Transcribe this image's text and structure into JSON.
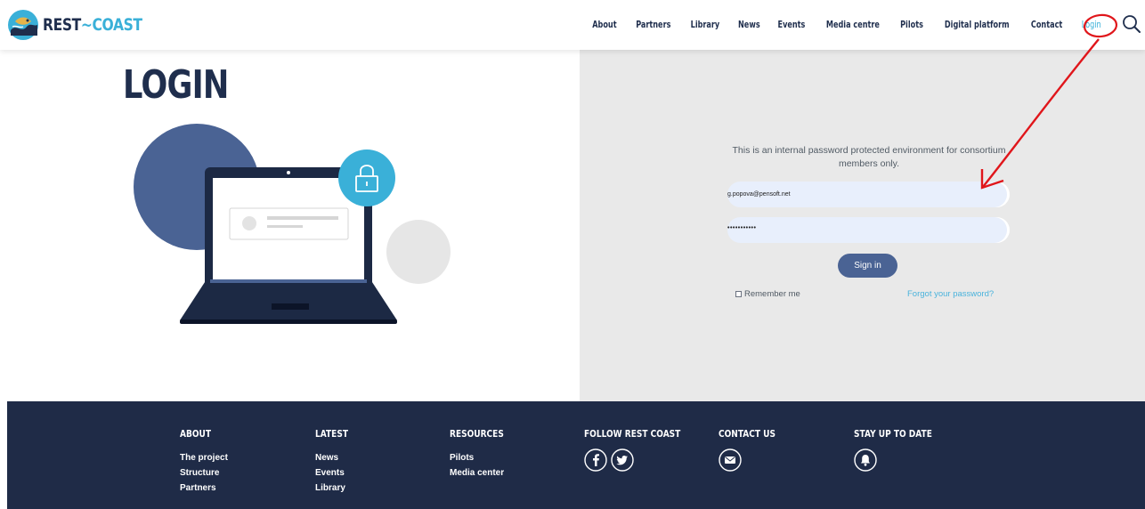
{
  "brand": {
    "logo_text_1": "REST",
    "logo_sep": "~",
    "logo_text_2": "COAST",
    "logo_icon": "fish-wave-logo-icon"
  },
  "nav": {
    "items": [
      "About",
      "Partners",
      "Library",
      "News",
      "Events",
      "Media centre",
      "Pilots",
      "Digital platform",
      "Contact",
      "Login"
    ],
    "active": "Login",
    "search_icon": "search-icon"
  },
  "main": {
    "title": "LOGIN",
    "illustration_icons": [
      "laptop-icon",
      "lock-icon"
    ]
  },
  "login_form": {
    "intro": "This is an internal password protected environment for consortium members only.",
    "email_value": "g.popova@pensoft.net",
    "password_value": "•••••••••••",
    "signin_label": "Sign in",
    "remember_label": "Remember me",
    "remember_checked": false,
    "forgot_label": "Forgot your password?"
  },
  "footer": {
    "about": {
      "heading": "ABOUT",
      "links": [
        "The project",
        "Structure",
        "Partners"
      ]
    },
    "latest": {
      "heading": "LATEST",
      "links": [
        "News",
        "Events",
        "Library"
      ]
    },
    "resources": {
      "heading": "RESOURCES",
      "links": [
        "Pilots",
        "Media center"
      ]
    },
    "follow": {
      "heading": "FOLLOW REST COAST",
      "icons": [
        "facebook-icon",
        "twitter-icon"
      ]
    },
    "contact": {
      "heading": "CONTACT US",
      "icons": [
        "mail-icon"
      ]
    },
    "stay": {
      "heading": "STAY UP TO DATE",
      "icons": [
        "bell-icon"
      ]
    }
  },
  "colors": {
    "navy": "#1f2e4d",
    "accent_blue": "#3ab0d8",
    "panel_gray": "#e9e9e9",
    "button_blue": "#4a6394",
    "footer_bg": "#1f2b47",
    "annotation_red": "#e0161b"
  },
  "annotation": {
    "type": "red-circle-and-arrow",
    "target": "Login"
  }
}
